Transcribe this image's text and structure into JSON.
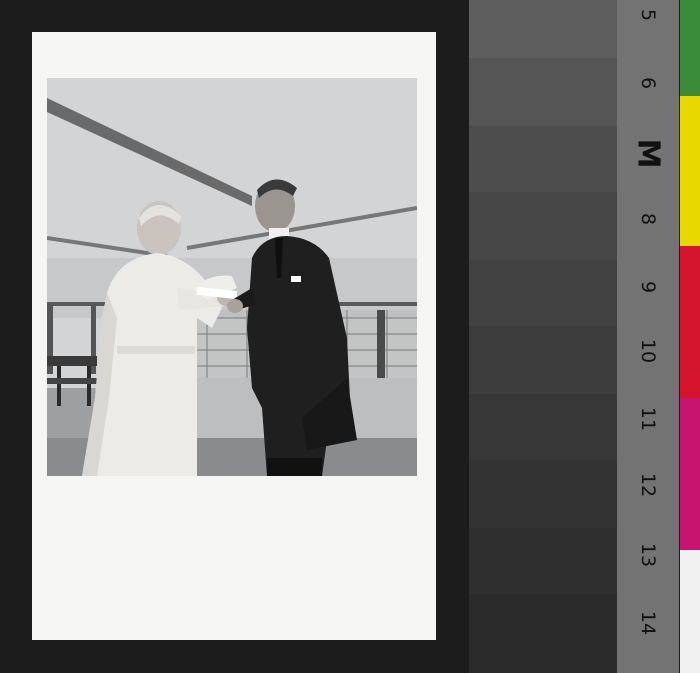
{
  "ruler": {
    "marks": [
      "5",
      "6",
      "M",
      "8",
      "9",
      "10",
      "11",
      "12",
      "13",
      "14"
    ]
  },
  "grayscale": {
    "colors": [
      "#5e5e5e",
      "#555555",
      "#4c4c4c",
      "#454545",
      "#3f3f3f",
      "#3a3a3a",
      "#363636",
      "#323232",
      "#2f2f2f",
      "#2c2c2c"
    ]
  },
  "color_strip": {
    "colors": [
      "#3a8a3a",
      "#e8d800",
      "#d4142c",
      "#c8146e",
      "#f0f0f0"
    ]
  },
  "photo": {
    "description_icons": [
      "woman-in-lab-coat",
      "man-in-suit",
      "railing",
      "steel-beam"
    ]
  }
}
